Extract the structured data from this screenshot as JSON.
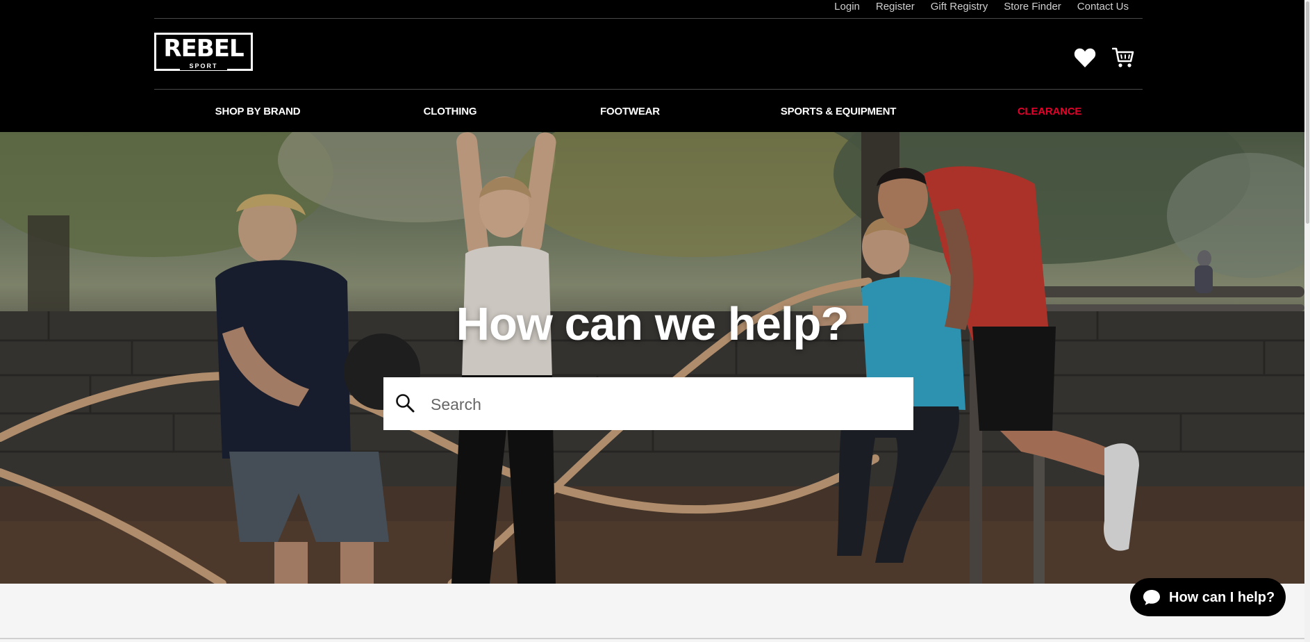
{
  "utility_nav": [
    "Login",
    "Register",
    "Gift Registry",
    "Store Finder",
    "Contact Us"
  ],
  "logo": {
    "main": "REBEL",
    "sub": "SPORT"
  },
  "header_icons": {
    "wishlist": "heart-icon",
    "cart": "cart-icon"
  },
  "main_nav": {
    "shop_by_brand": "SHOP BY BRAND",
    "clothing": "CLOTHING",
    "footwear": "FOOTWEAR",
    "sports_equipment": "SPORTS & EQUIPMENT",
    "clearance": "CLEARANCE"
  },
  "hero": {
    "title": "How can we help?"
  },
  "search": {
    "placeholder": "Search",
    "value": ""
  },
  "chat": {
    "label": "How can I help?"
  },
  "colors": {
    "header_bg": "#000000",
    "clearance": "#e4002b",
    "text_light": "#ffffff",
    "page_bg": "#f5f5f5"
  }
}
